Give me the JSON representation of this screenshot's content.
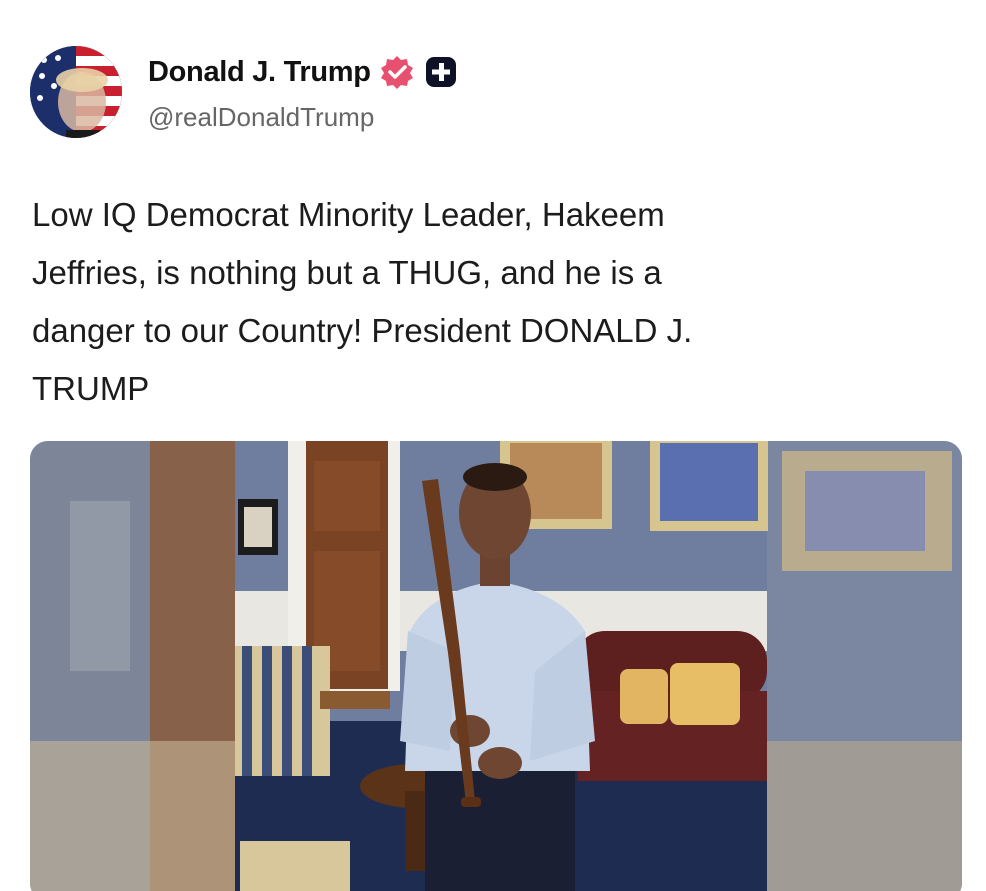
{
  "post": {
    "author": {
      "display_name": "Donald J. Trump",
      "handle": "@realDonaldTrump",
      "avatar_icon": "flag-portrait-avatar",
      "verified_icon": "verified-badge-icon",
      "extra_badge_icon": "plus-badge-icon"
    },
    "text": "Low IQ Democrat Minority Leader, Hakeem\nJeffries, is nothing but a THUG, and he is a\ndanger to our Country! President DONALD J.\nTRUMP",
    "media": {
      "type": "photo",
      "subject": "man in light blue shirt holding a baseball bat in an office"
    },
    "colors": {
      "verified": "#e8506f",
      "text": "#1c1c1c",
      "handle": "#666666"
    }
  }
}
